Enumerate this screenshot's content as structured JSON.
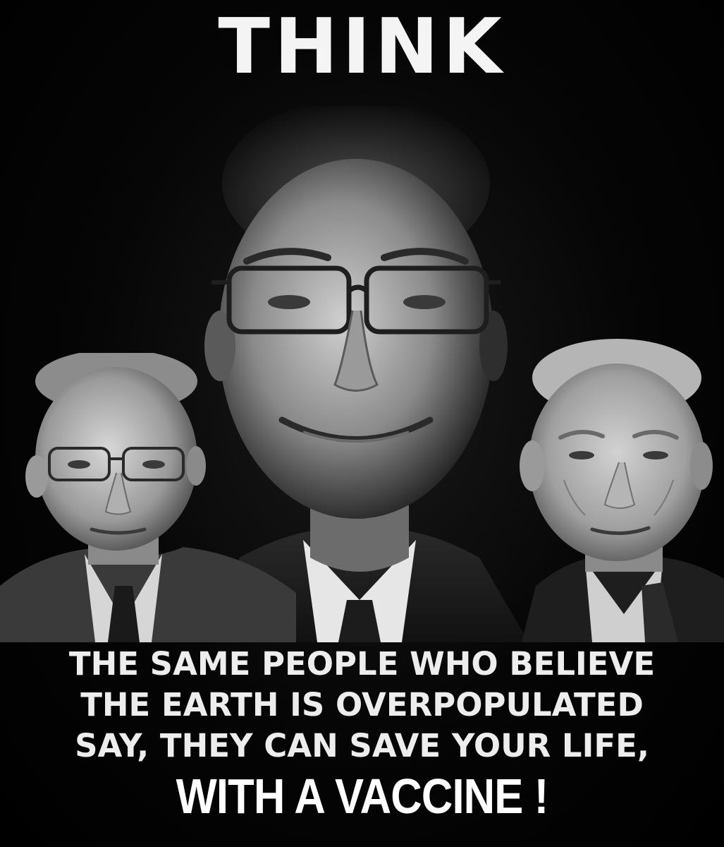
{
  "poster": {
    "headline": "THINK",
    "caption_lines": [
      "THE SAME PEOPLE WHO BELIEVE",
      "THE EARTH IS OVERPOPULATED",
      "SAY, THEY CAN SAVE YOUR LIFE,"
    ],
    "caption_emphasis": "WITH A VACCINE !"
  },
  "colors": {
    "background": "#000000",
    "text": "#f4f4f4"
  }
}
